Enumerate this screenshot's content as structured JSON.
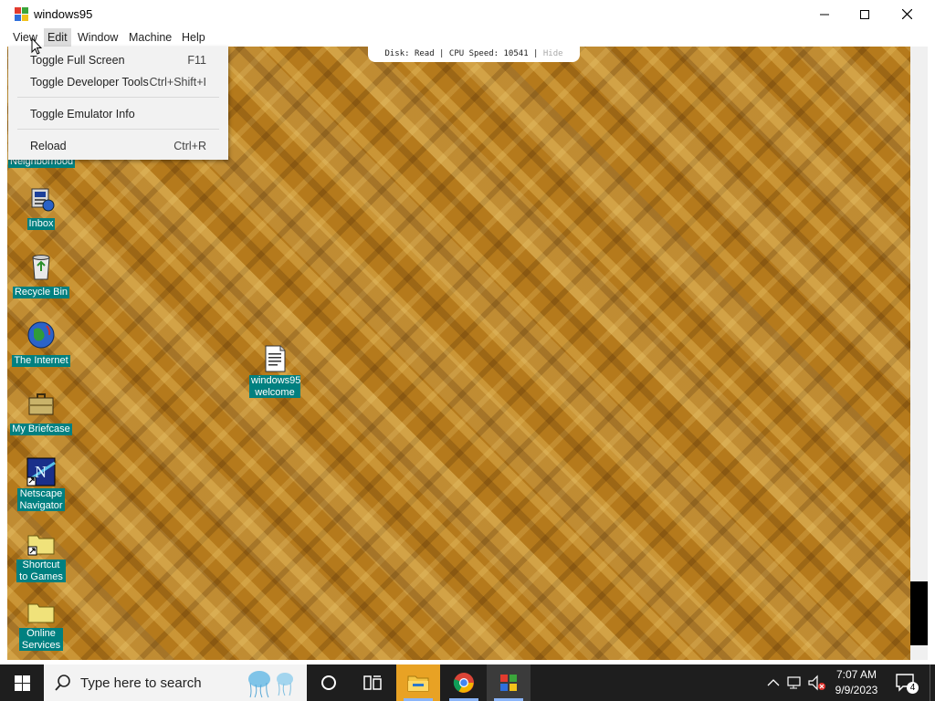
{
  "window": {
    "title": "windows95",
    "controls": {
      "minimize": "—",
      "maximize": "☐",
      "close": "✕"
    }
  },
  "menubar": {
    "items": [
      "View",
      "Edit",
      "Window",
      "Machine",
      "Help"
    ],
    "active": "Edit"
  },
  "dropdown": {
    "items": [
      {
        "label": "Toggle Full Screen",
        "shortcut": "F11"
      },
      {
        "label": "Toggle Developer Tools",
        "shortcut": "Ctrl+Shift+I"
      },
      {
        "label": "Toggle Emulator Info",
        "shortcut": ""
      },
      {
        "label": "Reload",
        "shortcut": "Ctrl+R"
      }
    ]
  },
  "status": {
    "disk_label": "Disk:",
    "disk_value": "Read",
    "cpu_label": "CPU Speed:",
    "cpu_value": "10541",
    "hide": "Hide"
  },
  "desktop": {
    "icons": [
      {
        "label": "Neighborhood",
        "icon": "network-neighborhood-icon"
      },
      {
        "label": "Inbox",
        "icon": "inbox-icon"
      },
      {
        "label": "Recycle Bin",
        "icon": "recycle-bin-icon"
      },
      {
        "label": "The Internet",
        "icon": "internet-globe-icon"
      },
      {
        "label": "My Briefcase",
        "icon": "briefcase-icon"
      },
      {
        "label": "Netscape Navigator",
        "icon": "netscape-icon"
      },
      {
        "label": "Shortcut to Games",
        "icon": "folder-shortcut-icon"
      },
      {
        "label": "Online Services",
        "icon": "folder-icon"
      },
      {
        "label": "windows95 welcome",
        "icon": "text-document-icon"
      }
    ],
    "wallpaper_base_color": "#b57a1c",
    "label_background": "#008080"
  },
  "taskbar": {
    "search_placeholder": "Type here to search",
    "time": "7:07 AM",
    "date": "9/9/2023",
    "notification_count": "4"
  }
}
